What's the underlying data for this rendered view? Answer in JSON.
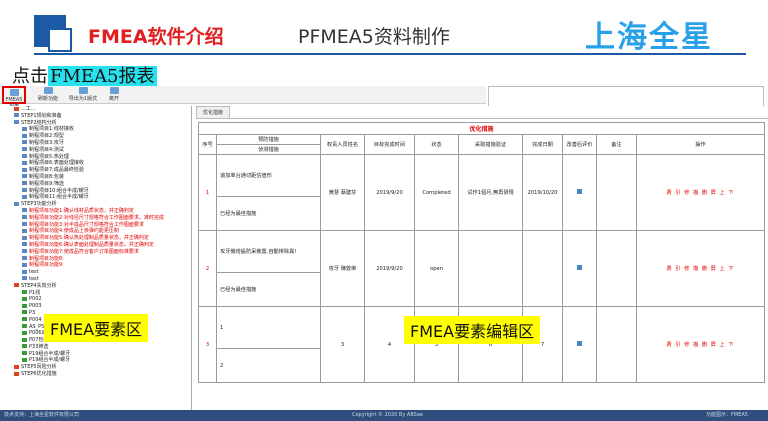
{
  "slide": {
    "title": "FMEA软件介绍",
    "subtitle": "PFMEA5资料制作",
    "brand": "上海全星",
    "instruction_prefix": "点击",
    "instruction_highlight": "FMEA5报表"
  },
  "toolbar": {
    "buttons": [
      "FMEA5报表",
      "刷新功能",
      "导出为1版式",
      "离开"
    ]
  },
  "tree": {
    "items": [
      {
        "label": "...工...",
        "level": 0,
        "style": "red-icon"
      },
      {
        "label": "STEP1规划和准备",
        "level": 0,
        "style": ""
      },
      {
        "label": "STEP2结构分析",
        "level": 0,
        "style": ""
      },
      {
        "label": "制程项目1:线材接收",
        "level": 1,
        "style": ""
      },
      {
        "label": "制程项目2:规型",
        "level": 1,
        "style": ""
      },
      {
        "label": "制程项目3:攻牙",
        "level": 1,
        "style": ""
      },
      {
        "label": "制程项目4:测试",
        "level": 1,
        "style": ""
      },
      {
        "label": "制程项目5:热处理",
        "level": 1,
        "style": ""
      },
      {
        "label": "制程项目6:表面处理接收",
        "level": 1,
        "style": ""
      },
      {
        "label": "制程项目7:成品最终检验",
        "level": 1,
        "style": ""
      },
      {
        "label": "制程项目8:包装",
        "level": 1,
        "style": ""
      },
      {
        "label": "制程项目9:筛选",
        "level": 1,
        "style": ""
      },
      {
        "label": "制程项目10:组合半成/螺牙",
        "level": 1,
        "style": ""
      },
      {
        "label": "制程项目11:组合半成/螺牙",
        "level": 1,
        "style": ""
      },
      {
        "label": "STEP3功能分析",
        "level": 0,
        "style": ""
      },
      {
        "label": "制程项目功能1:确认线材品质状态，并正确判定",
        "level": 1,
        "style": "red"
      },
      {
        "label": "制程项目功能2:对线径尺寸规格符合工作图面要求，准时完成",
        "level": 1,
        "style": "red"
      },
      {
        "label": "制程项目功能3:对半成品尺寸规格符合工作图面要求",
        "level": 1,
        "style": "red"
      },
      {
        "label": "制程项目功能4:使成品上亲弹约能更压制",
        "level": 1,
        "style": "red"
      },
      {
        "label": "制程项目功能5:确认热处理制品质量状态，并正确判定",
        "level": 1,
        "style": "red"
      },
      {
        "label": "制程项目功能6:确认表面处理制品质量状态，并正确判定",
        "level": 1,
        "style": "red"
      },
      {
        "label": "制程项目功能7:使成品符合客户订单图面标准要求",
        "level": 1,
        "style": "red"
      },
      {
        "label": "制程项目功能8:",
        "level": 1,
        "style": "red"
      },
      {
        "label": "制程项目功能9:",
        "level": 1,
        "style": "red"
      },
      {
        "label": "test",
        "level": 1,
        "style": ""
      },
      {
        "label": "test",
        "level": 1,
        "style": ""
      },
      {
        "label": "STEP4失效分析",
        "level": 0,
        "style": "red-icon"
      },
      {
        "label": "P1线",
        "level": 1,
        "style": "green-icon"
      },
      {
        "label": "P002",
        "level": 1,
        "style": "green-icon"
      },
      {
        "label": "P003",
        "level": 1,
        "style": "green-icon"
      },
      {
        "label": "P3",
        "level": 1,
        "style": "green-icon"
      },
      {
        "label": "P004",
        "level": 1,
        "style": "green-icon"
      },
      {
        "label": "AS_P5表面处理接收",
        "level": 1,
        "style": "green-icon"
      },
      {
        "label": "P006成品最终检验",
        "level": 1,
        "style": "green-icon"
      },
      {
        "label": "P07包装",
        "level": 1,
        "style": "green-icon"
      },
      {
        "label": "P33筛选",
        "level": 1,
        "style": "green-icon"
      },
      {
        "label": "P19组合半成/螺牙",
        "level": 1,
        "style": "green-icon"
      },
      {
        "label": "P19组合半成/螺牙",
        "level": 1,
        "style": "green-icon"
      },
      {
        "label": "STEP5风险分析",
        "level": 0,
        "style": "red-icon"
      },
      {
        "label": "STEP6优化措施",
        "level": 0,
        "style": "red-icon"
      }
    ]
  },
  "labels": {
    "tree_area": "FMEA要素区",
    "editor_area": "FMEA要素编辑区"
  },
  "editor": {
    "tab": "优化措施",
    "group_header": "优化措施",
    "columns": {
      "seq": "序号",
      "prevent": "预防措施",
      "detect": "侦测措施",
      "owner": "权责人员姓名",
      "target_date": "目标完成时间",
      "state": "状态",
      "taken": "采取措施验证",
      "done_date": "完成日期",
      "eval": "改善后评价",
      "note": "备注",
      "action": "操作"
    },
    "rows": [
      {
        "seq": "1",
        "prevent": "追加单台通切距估值形",
        "detect": "已经为最佳措施",
        "owner": "黄慧 蔡建芬",
        "target_date": "2019/9/20",
        "state": "Completed",
        "taken": "试作1個月,無再發現",
        "done_date": "2019/10/20",
        "note": ""
      },
      {
        "seq": "2",
        "prevent": "攻牙機增設防呆裝置,自動排除異!",
        "detect": "已经为最佳措施",
        "owner": "攻牙 陳敦荣",
        "target_date": "2019/9/20",
        "state": "open",
        "taken": "",
        "done_date": "",
        "note": ""
      },
      {
        "seq": "3",
        "prevent": "1",
        "detect": "2",
        "owner": "3",
        "target_date": "4",
        "state": "5",
        "taken": "6",
        "done_date": "7",
        "note": ""
      }
    ],
    "ops": "费 引 修 描 删 屏 上 下"
  },
  "status": {
    "left": "技术支持：上海全星软件有限公司",
    "center": "Copyright © 2020 By ABSae",
    "right": "功能图示：FMEA5"
  }
}
